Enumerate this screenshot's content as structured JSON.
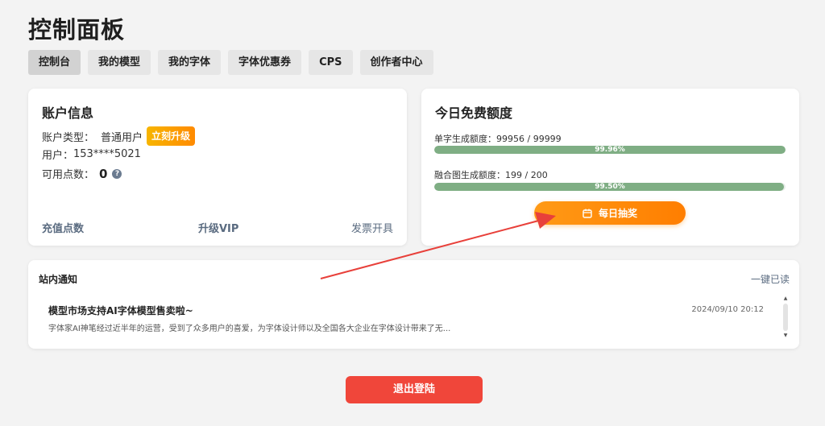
{
  "page": {
    "title": "控制面板"
  },
  "tabs": [
    {
      "label": "控制台",
      "active": true
    },
    {
      "label": "我的模型",
      "active": false
    },
    {
      "label": "我的字体",
      "active": false
    },
    {
      "label": "字体优惠券",
      "active": false
    },
    {
      "label": "CPS",
      "active": false
    },
    {
      "label": "创作者中心",
      "active": false
    }
  ],
  "account": {
    "title": "账户信息",
    "type_label": "账户类型：",
    "type_value": "普通用户",
    "upgrade_badge": "立刻升级",
    "user_label": "用户：",
    "user_value": "153****5021",
    "points_label": "可用点数：",
    "points_value": "0",
    "help_icon": "question-icon",
    "links": {
      "recharge": "充值点数",
      "vip": "升级VIP",
      "invoice": "发票开具"
    }
  },
  "quota": {
    "title": "今日免费额度",
    "single": {
      "label": "单字生成额度：99956 / 99999",
      "percent_text": "99.96%",
      "fraction": 0.9996
    },
    "fusion": {
      "label": "融合图生成额度：199 / 200",
      "percent_text": "99.50%",
      "fraction": 0.995
    },
    "lottery_label": "每日抽奖",
    "lottery_icon": "calendar-icon"
  },
  "notice": {
    "title": "站内通知",
    "mark_all_read": "一键已读",
    "items": [
      {
        "title": "模型市场支持AI字体模型售卖啦~",
        "time": "2024/09/10 20:12",
        "body": "字体家AI神笔经过近半年的运营，受到了众多用户的喜爱，为字体设计师以及全国各大企业在字体设计带来了无..."
      }
    ]
  },
  "logout_label": "退出登陆",
  "colors": {
    "accent_orange": "#ff8a00",
    "bar_green": "#7fae84",
    "logout_red": "#f0463a",
    "annotation_arrow": "#e8403a"
  }
}
